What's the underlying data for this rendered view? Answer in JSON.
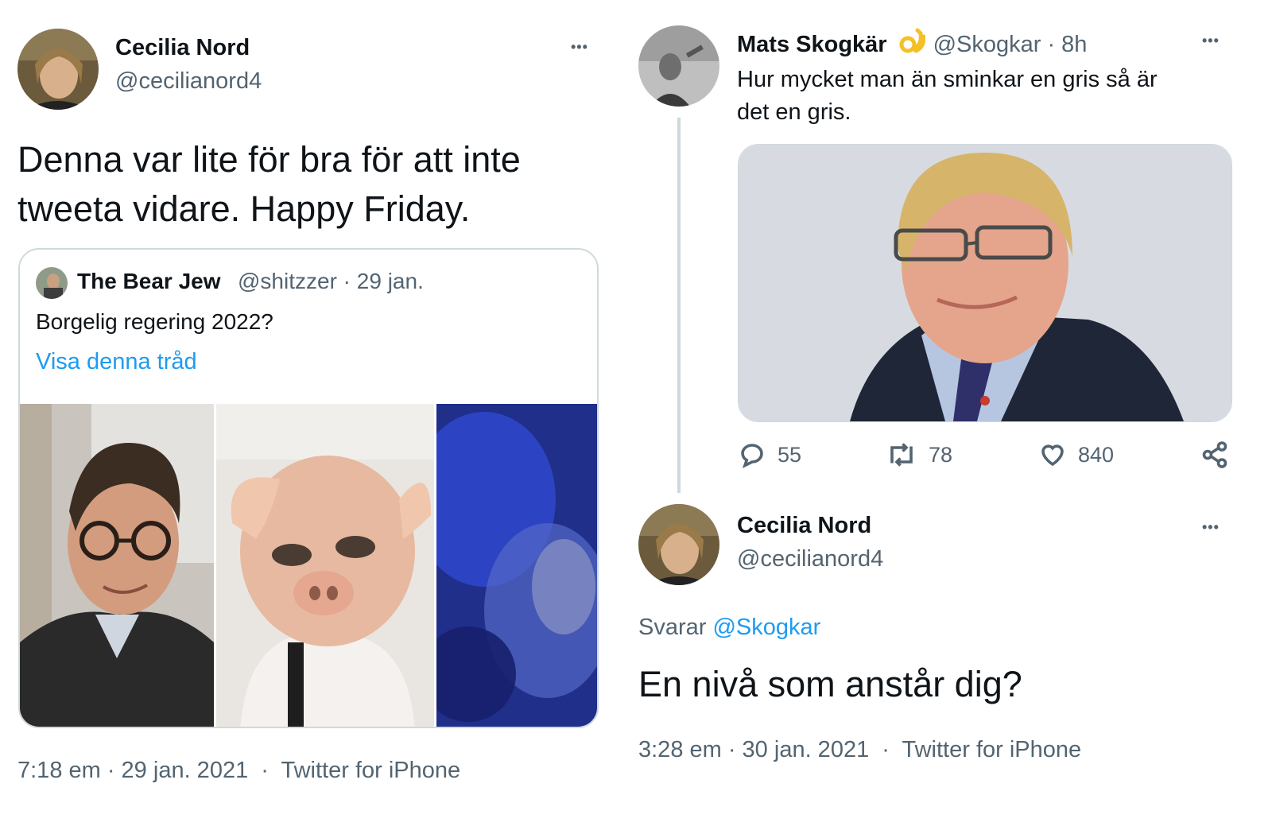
{
  "left_tweet": {
    "author_name": "Cecilia Nord",
    "author_handle": "@cecilianord4",
    "text_line1": "Denna var lite för bra för att inte",
    "text_line2": "tweeta vidare. Happy Friday.",
    "quote": {
      "author_name": "The Bear Jew",
      "meta": "@shitzzer · 29 jan.",
      "text": "Borgelig regering 2022?",
      "thread_link": "Visa denna tråd"
    },
    "timestamp": "7:18 em · 29 jan. 2021",
    "separator": "·",
    "source": "Twitter for iPhone"
  },
  "right_parent": {
    "author_name": "Mats Skogkär",
    "badge_icon": "ok-hand-emoji",
    "meta": "@Skogkar · 8h",
    "text_line1": "Hur mycket man än sminkar en gris så är",
    "text_line2": "det en gris.",
    "stats": {
      "replies": "55",
      "retweets": "78",
      "likes": "840"
    }
  },
  "right_reply": {
    "author_name": "Cecilia Nord",
    "author_handle": "@cecilianord4",
    "replying_prefix": "Svarar",
    "replying_to": "@Skogkar",
    "text": "En nivå som anstår dig?",
    "timestamp": "3:28 em · 30 jan. 2021",
    "separator": "·",
    "source": "Twitter for iPhone"
  },
  "more_glyph": "•••",
  "colors": {
    "link": "#1d9bf0",
    "muted": "#536471",
    "text": "#0f1419",
    "border": "#cfd9de"
  }
}
